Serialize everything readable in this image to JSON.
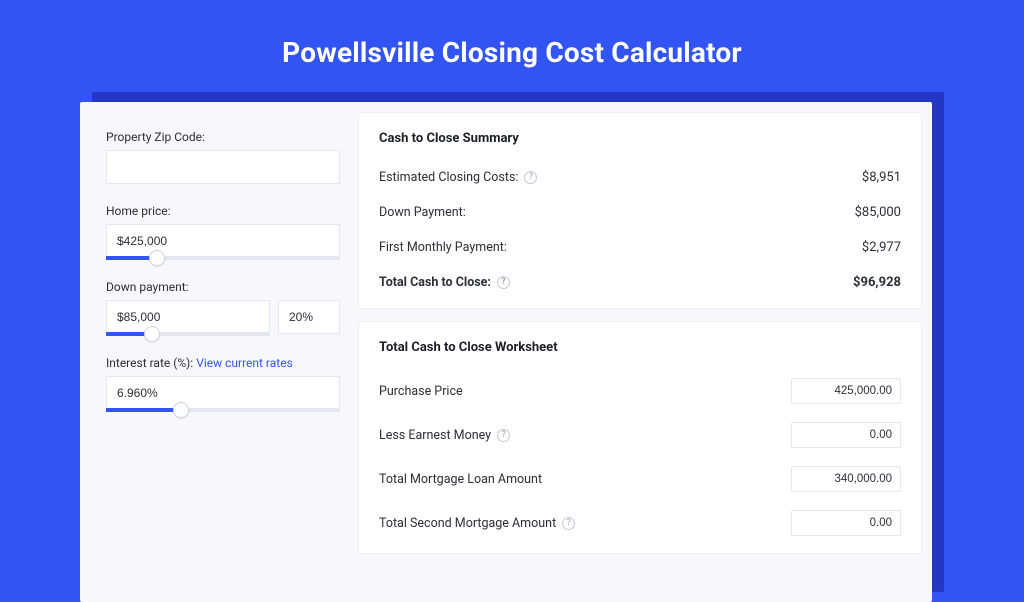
{
  "page": {
    "title": "Powellsville Closing Cost Calculator"
  },
  "left": {
    "zip_label": "Property Zip Code:",
    "zip_value": "",
    "home_label": "Home price:",
    "home_value": "$425,000",
    "home_slider_pct": 22,
    "down_label": "Down payment:",
    "down_value": "$85,000",
    "down_pct_value": "20%",
    "down_slider_pct": 28,
    "rate_label": "Interest rate (%):",
    "rate_link": "View current rates",
    "rate_value": "6.960%",
    "rate_slider_pct": 32
  },
  "summary": {
    "title": "Cash to Close Summary",
    "rows": [
      {
        "label": "Estimated Closing Costs:",
        "value": "$8,951",
        "help": true
      },
      {
        "label": "Down Payment:",
        "value": "$85,000",
        "help": false
      },
      {
        "label": "First Monthly Payment:",
        "value": "$2,977",
        "help": false
      }
    ],
    "total_label": "Total Cash to Close:",
    "total_value": "$96,928"
  },
  "worksheet": {
    "title": "Total Cash to Close Worksheet",
    "rows": [
      {
        "label": "Purchase Price",
        "value": "425,000.00",
        "help": false
      },
      {
        "label": "Less Earnest Money",
        "value": "0.00",
        "help": true
      },
      {
        "label": "Total Mortgage Loan Amount",
        "value": "340,000.00",
        "help": false
      },
      {
        "label": "Total Second Mortgage Amount",
        "value": "0.00",
        "help": true
      }
    ]
  }
}
